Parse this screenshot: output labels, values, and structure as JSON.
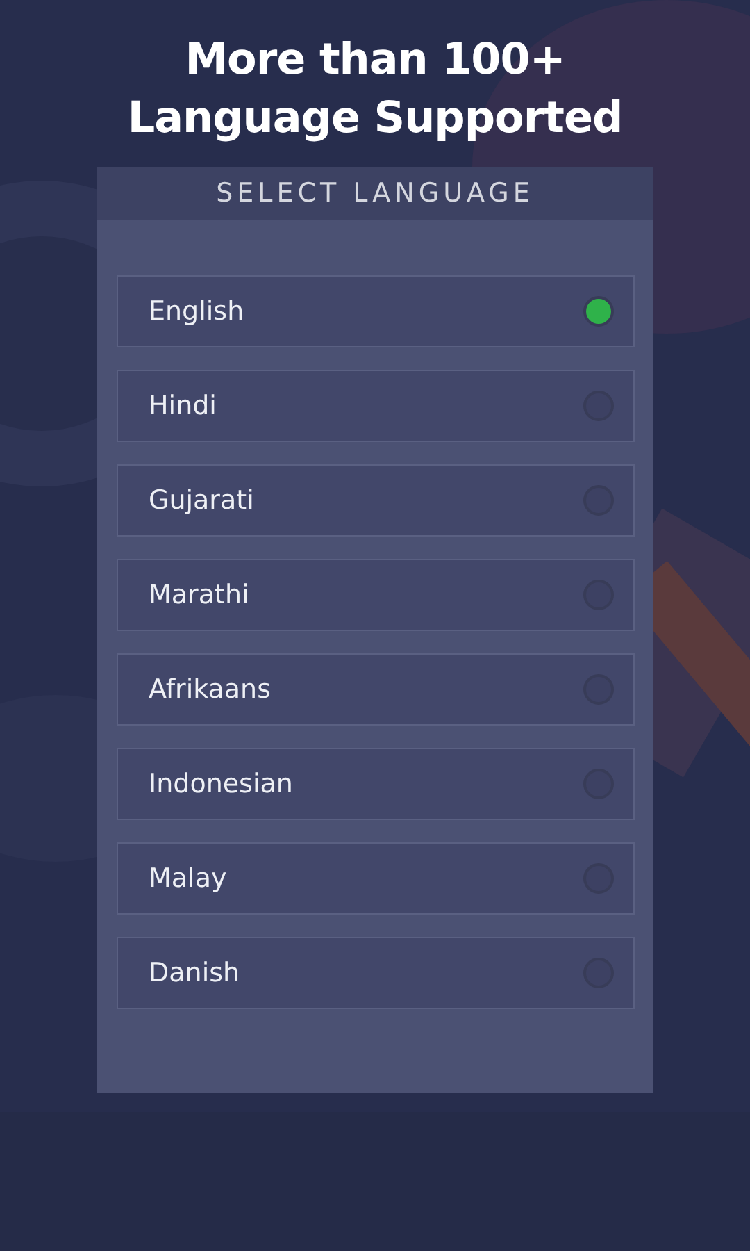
{
  "headline": [
    "More than 100+",
    "Language Supported"
  ],
  "dialog": {
    "title": "SELECT LANGUAGE",
    "languages": [
      {
        "label": "English",
        "selected": true
      },
      {
        "label": "Hindi",
        "selected": false
      },
      {
        "label": "Gujarati",
        "selected": false
      },
      {
        "label": "Marathi",
        "selected": false
      },
      {
        "label": "Afrikaans",
        "selected": false
      },
      {
        "label": "Indonesian",
        "selected": false
      },
      {
        "label": "Malay",
        "selected": false
      },
      {
        "label": "Danish",
        "selected": false
      }
    ]
  }
}
